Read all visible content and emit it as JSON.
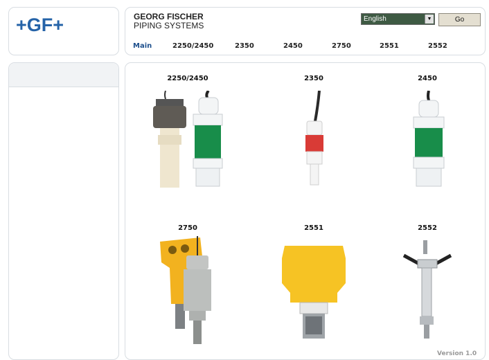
{
  "logo": {
    "text": "+GF+"
  },
  "brand": {
    "line1": "GEORG FISCHER",
    "line2": "PIPING SYSTEMS"
  },
  "language": {
    "selected": "English"
  },
  "go_button": {
    "label": "Go"
  },
  "nav": [
    "Main",
    "2250/2450",
    "2350",
    "2450",
    "2750",
    "2551",
    "2552"
  ],
  "products": [
    {
      "label": "2250/2450"
    },
    {
      "label": "2350"
    },
    {
      "label": "2450"
    },
    {
      "label": "2750"
    },
    {
      "label": "2551"
    },
    {
      "label": "2552"
    }
  ],
  "version": "Version 1.0",
  "colors": {
    "accent": "#2563a8",
    "nav_active": "#1d4f8c"
  }
}
